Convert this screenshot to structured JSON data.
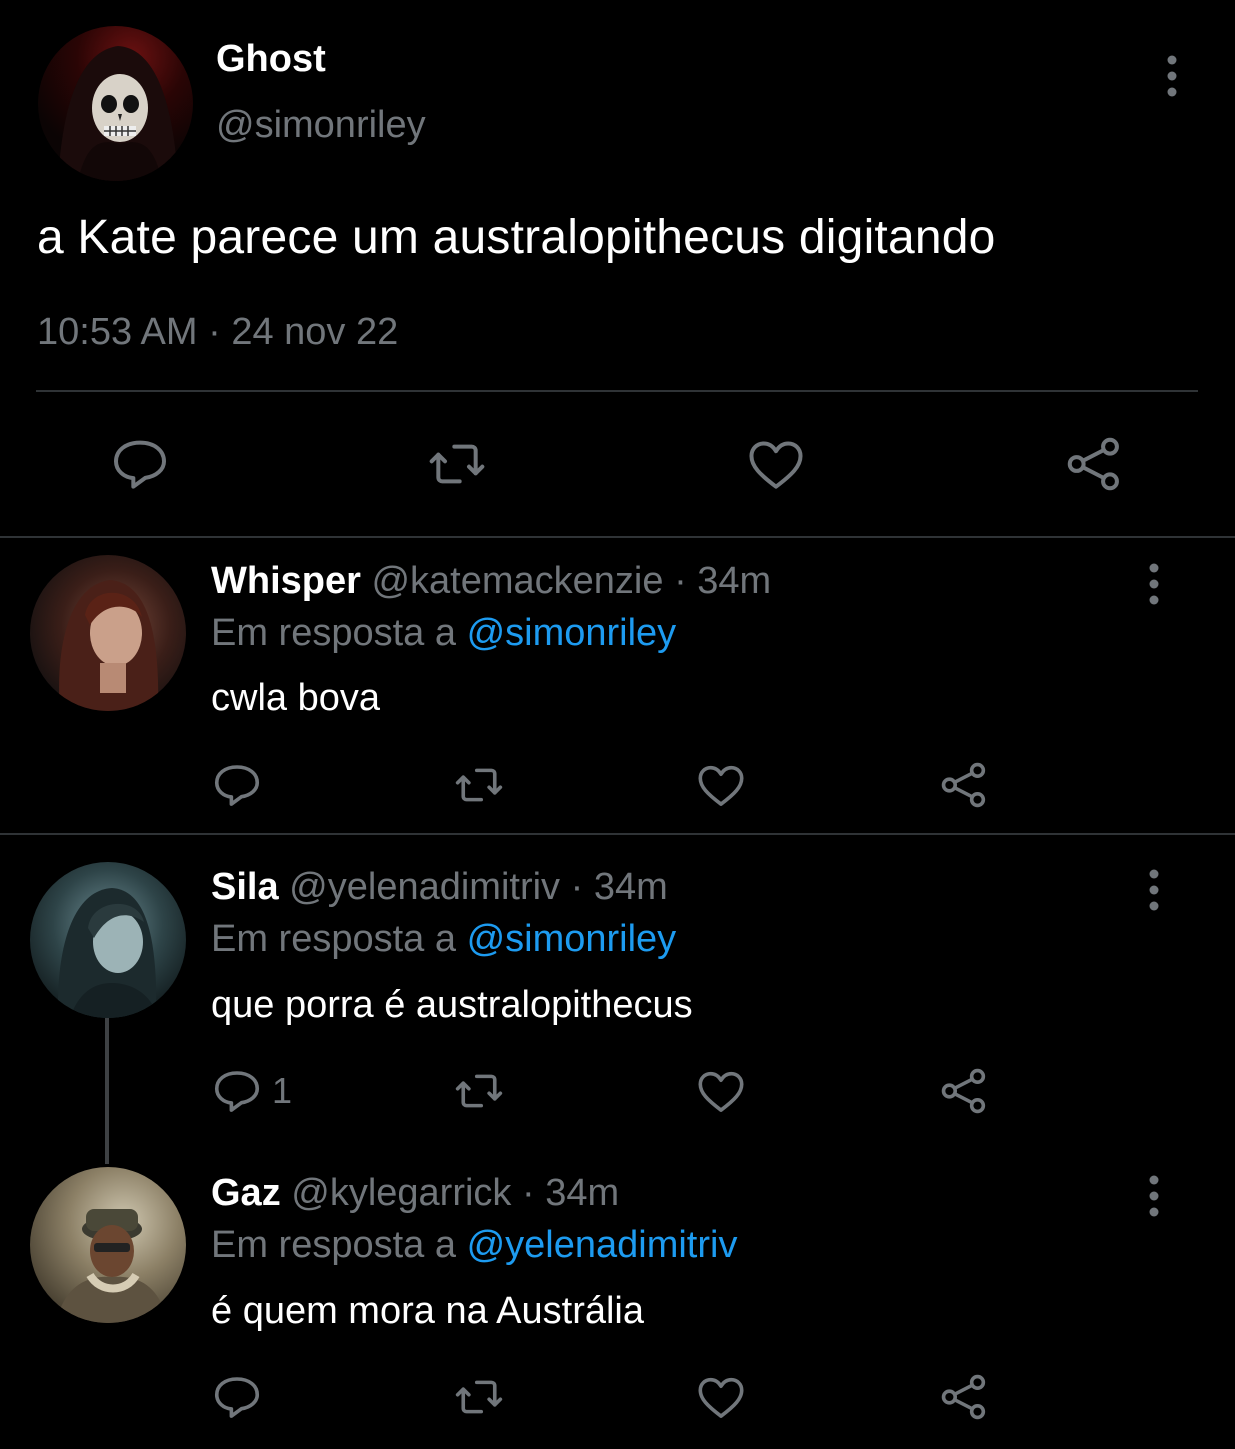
{
  "main_tweet": {
    "author_name": "Ghost",
    "author_handle": "@simonriley",
    "text": "a Kate parece um australopithecus digitando",
    "time": "10:53 AM",
    "separator": " · ",
    "date": "24 nov 22",
    "avatar_icon": "skull-mask-avatar",
    "actions": [
      "reply-icon",
      "retweet-icon",
      "like-icon",
      "share-icon"
    ]
  },
  "replies": [
    {
      "name": "Whisper",
      "handle": "@katemackenzie",
      "time": "· 34m",
      "in_reply_prefix": "Em resposta a",
      "in_reply_to": "@simonriley",
      "text": "cwla bova",
      "reply_count": ""
    },
    {
      "name": "Sila",
      "handle": "@yelenadimitriv",
      "time": "· 34m",
      "in_reply_prefix": "Em resposta a",
      "in_reply_to": "@simonriley",
      "text": "que porra é australopithecus",
      "reply_count": "1"
    },
    {
      "name": "Gaz",
      "handle": "@kylegarrick",
      "time": "· 34m",
      "in_reply_prefix": "Em resposta a",
      "in_reply_to": "@yelenadimitriv",
      "text": "é quem mora na Austrália",
      "reply_count": ""
    }
  ],
  "colors": {
    "background": "#000000",
    "text": "#ffffff",
    "secondary": "#71767b",
    "mention": "#1d9bf0",
    "divider": "#2f3336"
  }
}
